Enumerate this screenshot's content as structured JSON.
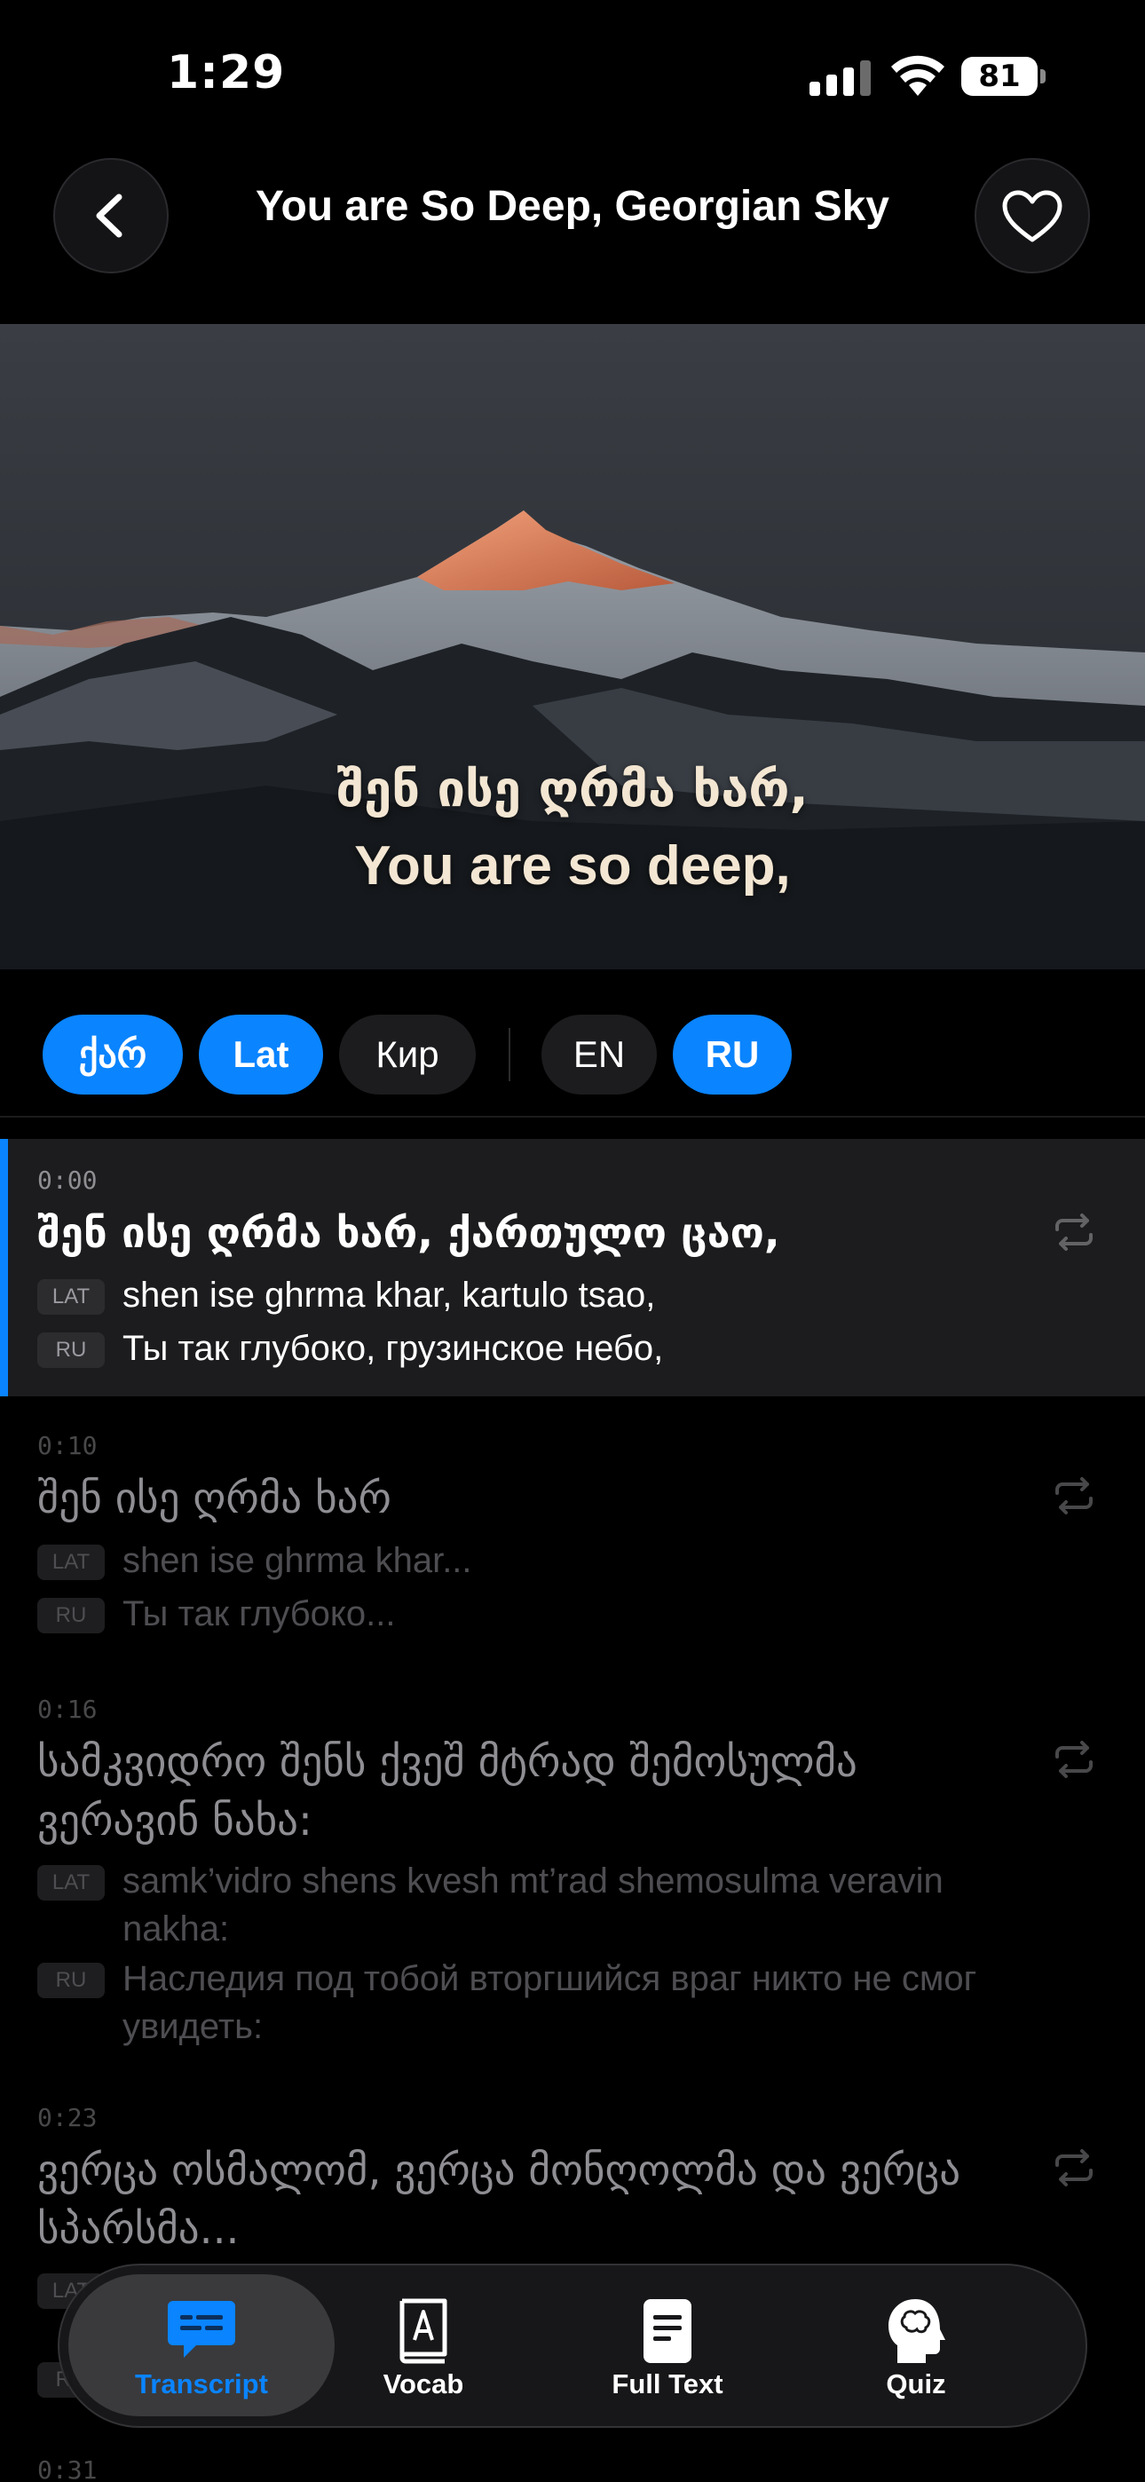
{
  "status_bar": {
    "time": "1:29",
    "battery": "81"
  },
  "header": {
    "title": "You are So Deep, Georgian Sky"
  },
  "video": {
    "subtitle_georgian": "შენ ისე ღრმა ხარ,",
    "subtitle_english": "You are so deep,"
  },
  "script_toggles": [
    {
      "label": "ქარ",
      "active": true
    },
    {
      "label": "Lat",
      "active": true
    },
    {
      "label": "Кир",
      "active": false
    }
  ],
  "translation_toggles": [
    {
      "label": "EN",
      "active": false
    },
    {
      "label": "RU",
      "active": true
    }
  ],
  "transcript": [
    {
      "time": "0:00",
      "georgian": "შენ ისე ღრმა ხარ, ქართულო ცაო,",
      "lat_tag": "LAT",
      "latin": "shen ise ghrma khar, kartulo tsao,",
      "ru_tag": "RU",
      "russian": "Ты так глубоко, грузинское небо,",
      "active": true
    },
    {
      "time": "0:10",
      "georgian": "შენ ისე ღრმა ხარ",
      "lat_tag": "LAT",
      "latin": "shen ise ghrma khar...",
      "ru_tag": "RU",
      "russian": "Ты так глубоко...",
      "active": false
    },
    {
      "time": "0:16",
      "georgian": "სამკვიდრო შენს ქვეშ მტრად შემოსულმა ვერავინ ნახა:",
      "lat_tag": "LAT",
      "latin": "samk’vidro shens kvesh mt’rad shemosulma veravin nakha:",
      "ru_tag": "RU",
      "russian": "Наследия под тобой вторгшийся враг никто не смог увидеть:",
      "active": false
    },
    {
      "time": "0:23",
      "georgian": "ვერცა ოსმალომ, ვერცა მონღოლმა და ვერცა სპარსმა...",
      "lat_tag": "LAT",
      "latin": "",
      "ru_tag": "RU",
      "russian": "",
      "active": false
    },
    {
      "time": "0:31",
      "georgian": "",
      "active": false
    }
  ],
  "tabbar": {
    "tabs": [
      {
        "label": "Transcript",
        "icon": "transcript-icon",
        "selected": true
      },
      {
        "label": "Vocab",
        "icon": "vocab-book-icon",
        "selected": false
      },
      {
        "label": "Full Text",
        "icon": "document-icon",
        "selected": false
      },
      {
        "label": "Quiz",
        "icon": "brain-head-icon",
        "selected": false
      }
    ]
  },
  "colors": {
    "accent": "#0a84ff",
    "active_row": "#1c1c1e",
    "background": "#000000"
  }
}
